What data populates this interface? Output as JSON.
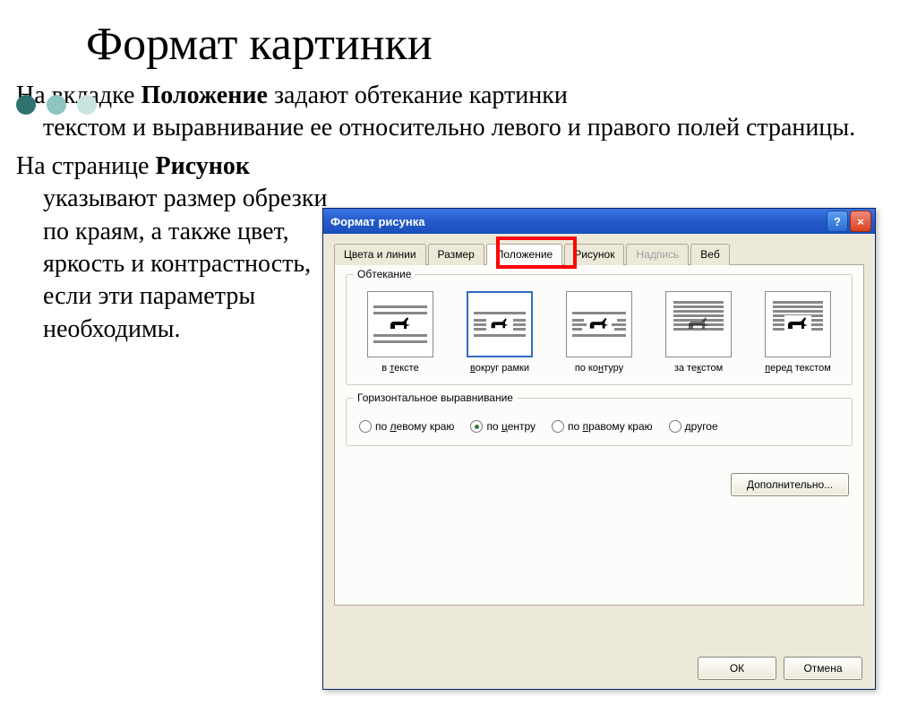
{
  "slide": {
    "title": "Формат картинки",
    "para1_prefix": "На вкладке ",
    "para1_bold": "Положение",
    "para1_suffix": " задают обтекание картинки",
    "para1_cont": "текстом и выравнивание ее относительно левого и правого полей страницы.",
    "para2_prefix": "На странице ",
    "para2_bold": "Рисунок",
    "para2_cont": "указывают размер обрезки по краям, а также цвет, яркость и контрастность, если эти параметры необходимы."
  },
  "dialog": {
    "title": "Формат рисунка",
    "help": "?",
    "close": "×",
    "tabs": {
      "colors": "Цвета и линии",
      "size": "Размер",
      "position": "Положение",
      "picture": "Рисунок",
      "caption": "Надпись",
      "web": "Веб"
    },
    "wrap": {
      "group_title": "Обтекание",
      "items": [
        {
          "label": "в тексте",
          "ul": "т"
        },
        {
          "label": "округ рамки",
          "ul": "в"
        },
        {
          "label": "по ко",
          "ul_mid": "н",
          "label_after": "туру"
        },
        {
          "label": "за те",
          "ul_mid": "к",
          "label_after": "стом"
        },
        {
          "label": "еред текстом",
          "ul": "п"
        }
      ]
    },
    "align": {
      "group_title": "Горизонтальное выравнивание",
      "left": "по левому краю",
      "left_ul": "л",
      "center": "по центру",
      "center_ul": "ц",
      "right": "по правому краю",
      "right_ul": "п",
      "other": "другое",
      "other_ul": "д"
    },
    "buttons": {
      "more": "Дополнительно...",
      "ok": "ОК",
      "cancel": "Отмена"
    }
  }
}
